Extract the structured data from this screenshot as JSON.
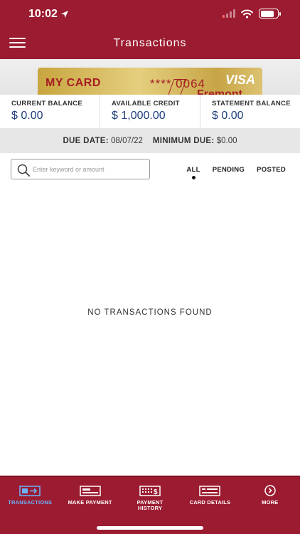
{
  "status_bar": {
    "time": "10:02"
  },
  "header": {
    "title": "Transactions"
  },
  "card": {
    "name": "MY CARD",
    "masked_number": "**** 0064",
    "network": "VISA",
    "brand": "Fremont"
  },
  "balances": [
    {
      "label": "CURRENT BALANCE",
      "value": "$ 0.00"
    },
    {
      "label": "AVAILABLE CREDIT",
      "value": "$ 1,000.00"
    },
    {
      "label": "STATEMENT BALANCE",
      "value": "$ 0.00"
    }
  ],
  "due": {
    "date_label": "DUE DATE:",
    "date_value": "08/07/22",
    "min_label": "MINIMUM DUE:",
    "min_value": "$0.00"
  },
  "search": {
    "placeholder": "Enter keyword or amount"
  },
  "filters": [
    {
      "label": "ALL",
      "active": true
    },
    {
      "label": "PENDING",
      "active": false
    },
    {
      "label": "POSTED",
      "active": false
    }
  ],
  "empty_message": "NO TRANSACTIONS FOUND",
  "bottom_nav": [
    {
      "label": "TRANSACTIONS",
      "icon": "transactions-icon",
      "active": true
    },
    {
      "label": "MAKE PAYMENT",
      "icon": "credit-card-icon",
      "active": false
    },
    {
      "label": "PAYMENT HISTORY",
      "icon": "calendar-dollar-icon",
      "active": false
    },
    {
      "label": "CARD DETAILS",
      "icon": "card-details-icon",
      "active": false
    },
    {
      "label": "MORE",
      "icon": "chevron-right-circle-icon",
      "active": false
    }
  ],
  "colors": {
    "brand": "#9b1b30",
    "active_nav": "#6ab4ff",
    "balance_value": "#1c3e7a",
    "card_text": "#a51e23"
  }
}
